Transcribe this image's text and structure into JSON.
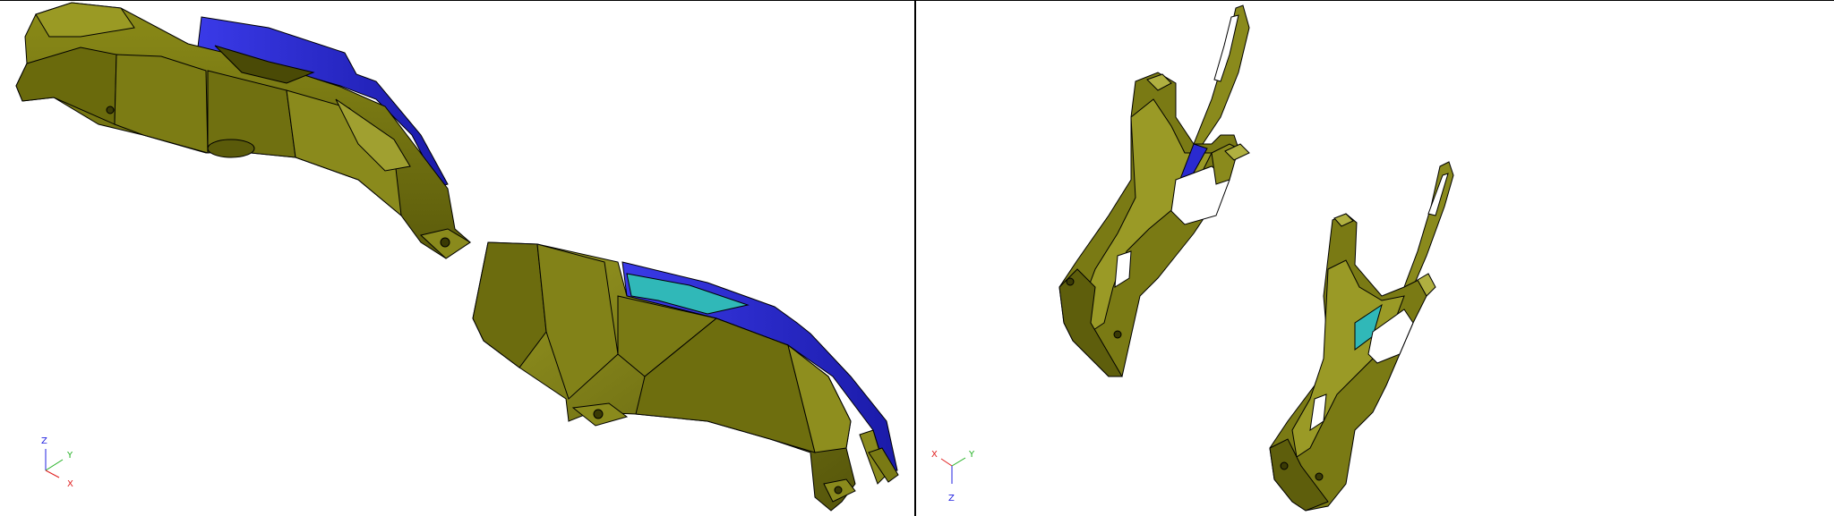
{
  "viewports": [
    {
      "id": "left",
      "triad": {
        "z_label": "Z",
        "y_label": "Y",
        "x_label": "X"
      }
    },
    {
      "id": "right",
      "triad": {
        "x_label": "X",
        "y_label": "Y",
        "z_label": "Z"
      }
    }
  ],
  "colors": {
    "part_olive": "#7a7a10",
    "part_olive_light": "#9a9a20",
    "part_olive_dark": "#4e4e08",
    "part_blue": "#2a2ad0",
    "part_cyan": "#30b8b8",
    "axis_x": "#e02020",
    "axis_y": "#20b020",
    "axis_z": "#2020e0",
    "edge": "#1a1a00"
  }
}
